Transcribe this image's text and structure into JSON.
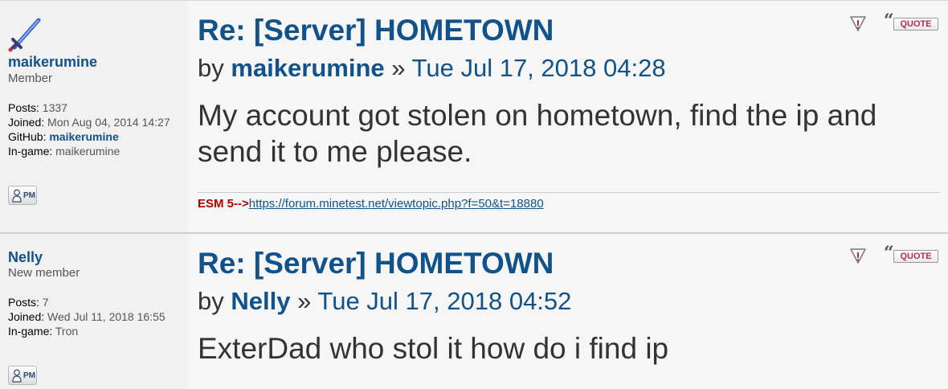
{
  "posts": [
    {
      "author": {
        "name": "maikerumine",
        "rank": "Member",
        "posts_label": "Posts:",
        "posts": "1337",
        "joined_label": "Joined:",
        "joined": "Mon Aug 04, 2014 14:27",
        "github_label": "GitHub:",
        "github": "maikerumine",
        "ingame_label": "In-game:",
        "ingame": "maikerumine",
        "pm_label": "PM"
      },
      "title": "Re: [Server] HOMETOWN",
      "by": "by",
      "by_author": "maikerumine",
      "sep": "»",
      "date": "Tue Jul 17, 2018 04:28",
      "content": "My account got stolen on hometown, find the ip and send it to me please.",
      "signature": {
        "label": "ESM 5-->",
        "link": "https://forum.minetest.net/viewtopic.php?f=50&t=18880"
      },
      "quote_label": "QUOTE"
    },
    {
      "author": {
        "name": "Nelly",
        "rank": "New member",
        "posts_label": "Posts:",
        "posts": "7",
        "joined_label": "Joined:",
        "joined": "Wed Jul 11, 2018 16:55",
        "ingame_label": "In-game:",
        "ingame": "Tron",
        "pm_label": "PM"
      },
      "title": "Re: [Server] HOMETOWN",
      "by": "by",
      "by_author": "Nelly",
      "sep": "»",
      "date": "Tue Jul 17, 2018 04:52",
      "content": "ExterDad who stol it how do i find ip",
      "quote_label": "QUOTE"
    }
  ],
  "icons": {
    "avatar": "sword-icon",
    "report": "report-warning-icon",
    "quote": "quote-icon",
    "pm": "private-message-icon"
  },
  "colors": {
    "link": "#105289",
    "signature_label": "#b50000",
    "quote_text": "#bc2a4d",
    "background": "#f6f6f6"
  }
}
